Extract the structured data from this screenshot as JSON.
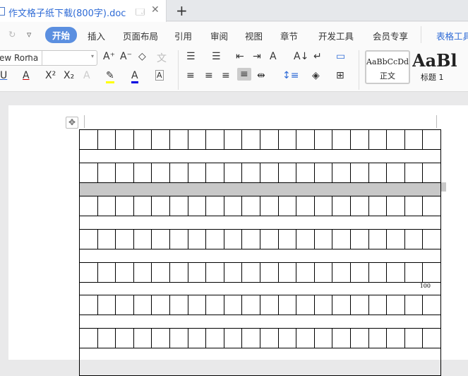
{
  "tab": {
    "title": "作文格子纸下载(800字).doc",
    "new_tab": "+"
  },
  "menu": {
    "items": [
      "开始",
      "插入",
      "页面布局",
      "引用",
      "审阅",
      "视图",
      "章节",
      "开发工具",
      "会员专享"
    ],
    "context_tab": "表格工具"
  },
  "ribbon": {
    "font_name": "ew Roma",
    "font_size": "",
    "styles": [
      {
        "preview": "AaBbCcDd",
        "label": "正文"
      },
      {
        "preview": "AaBl",
        "label": "标题 1"
      }
    ]
  },
  "document": {
    "grid_columns": 20,
    "char_count_label": "100",
    "rows": [
      "cells",
      "spacer",
      "cells",
      "gray",
      "cells",
      "spacer",
      "cells",
      "spacer",
      "cells",
      "count",
      "cells",
      "spacer",
      "cells",
      "spacer"
    ]
  }
}
